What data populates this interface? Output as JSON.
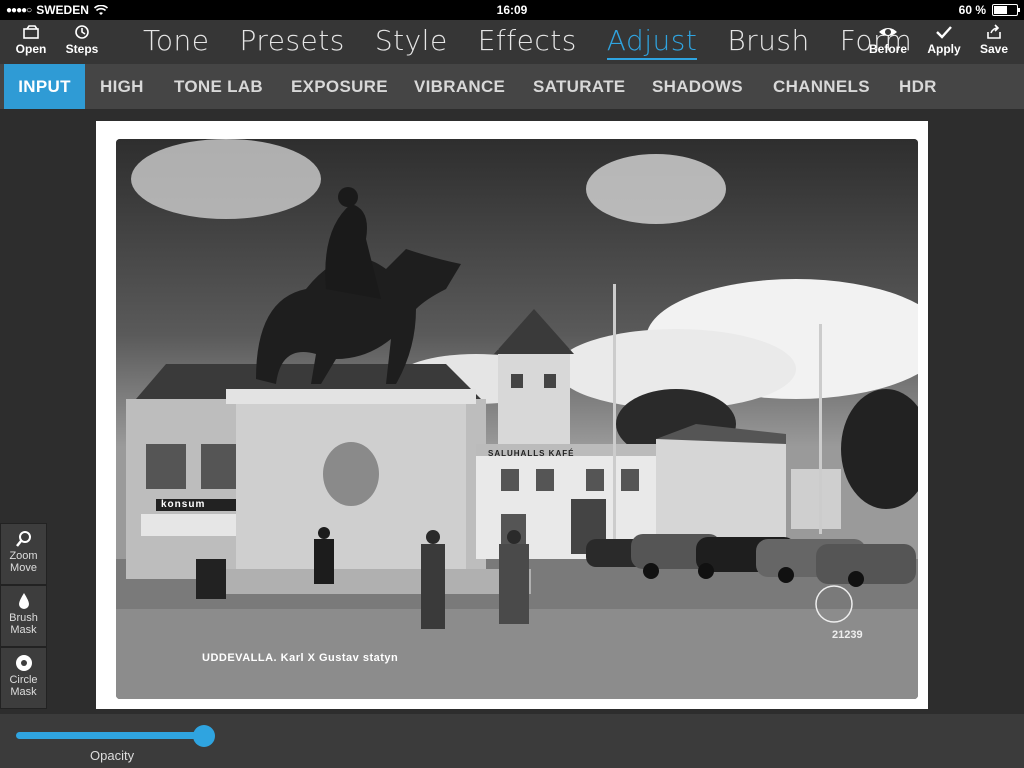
{
  "status": {
    "carrier": "SWEDEN",
    "time": "16:09",
    "battery": "60 %",
    "battery_level": 0.6
  },
  "toolbar": {
    "open_label": "Open",
    "steps_label": "Steps",
    "before_label": "Before",
    "apply_label": "Apply",
    "save_label": "Save",
    "tabs": [
      {
        "label": "Tone"
      },
      {
        "label": "Presets"
      },
      {
        "label": "Style"
      },
      {
        "label": "Effects"
      },
      {
        "label": "Adjust",
        "active": true
      },
      {
        "label": "Brush"
      },
      {
        "label": "Form"
      }
    ]
  },
  "subtabs": [
    {
      "label": "INPUT",
      "active": true
    },
    {
      "label": "HIGH"
    },
    {
      "label": "TONE LAB"
    },
    {
      "label": "EXPOSURE"
    },
    {
      "label": "VIBRANCE"
    },
    {
      "label": "SATURATE"
    },
    {
      "label": "SHADOWS"
    },
    {
      "label": "CHANNELS"
    },
    {
      "label": "HDR"
    }
  ],
  "photo": {
    "caption": "UDDEVALLA. Karl X Gustav statyn",
    "shop_sign": "konsum",
    "building_sign": "SALUHALLS KAFÉ",
    "stamp_number": "21239"
  },
  "left_tools": [
    {
      "line1": "Zoom",
      "line2": "Move",
      "icon": "zoom-icon"
    },
    {
      "line1": "Brush",
      "line2": "Mask",
      "icon": "droplet-icon"
    },
    {
      "line1": "Circle",
      "line2": "Mask",
      "icon": "circle-mask-icon"
    }
  ],
  "opacity": {
    "label": "Opacity",
    "value": 1.0
  },
  "colors": {
    "accent": "#2fa4e0",
    "toolbar": "#363636",
    "subbar": "#454545",
    "background": "#2d2d2d"
  }
}
